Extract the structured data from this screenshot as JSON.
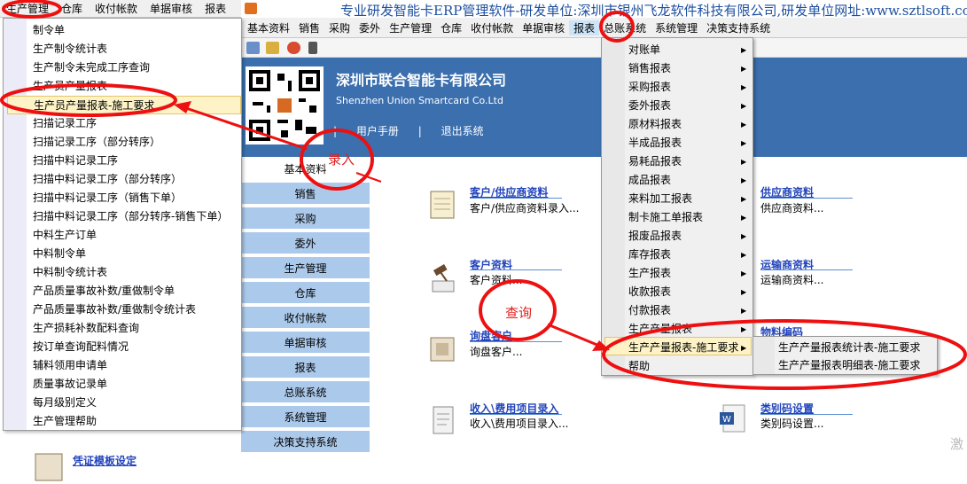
{
  "outer_menu": [
    "生产管理",
    "仓库",
    "收付帐款",
    "单据审核",
    "报表"
  ],
  "left_menu": [
    "制令单",
    "生产制令统计表",
    "生产制令未完成工序查询",
    "生产员产量报表",
    "生产员产量报表-施工要求",
    "扫描记录工序",
    "扫描记录工序（部分转序）",
    "扫描中料记录工序",
    "扫描中料记录工序（部分转序）",
    "扫描中料记录工序（销售下单）",
    "扫描中料记录工序（部分转序-销售下单）",
    "中料生产订单",
    "中料制令单",
    "中料制令统计表",
    "产品质量事故补数/重做制令单",
    "产品质量事故补数/重做制令统计表",
    "生产损耗补数配料查询",
    "按订单查询配料情况",
    "辅料领用申请单",
    "质量事故记录单",
    "每月级别定义",
    "生产管理帮助"
  ],
  "title_banner": "专业研发智能卡ERP管理软件-研发单位:深圳市银州飞龙软件科技有限公司,研发单位网址:www.sztlsoft.com",
  "main_menu": [
    "基本资料",
    "销售",
    "采购",
    "委外",
    "生产管理",
    "仓库",
    "收付帐款",
    "单据审核",
    "报表",
    "总账系统",
    "系统管理",
    "决策支持系统"
  ],
  "banner": {
    "company_cn": "深圳市联合智能卡有限公司",
    "company_en": "Shenzhen Union Smartcard Co.Ltd",
    "links": [
      "|",
      "用户手册",
      "|",
      "退出系统"
    ]
  },
  "side_nav": [
    "基本资料",
    "销售",
    "采购",
    "委外",
    "生产管理",
    "仓库",
    "收付帐款",
    "单据审核",
    "报表",
    "总账系统",
    "系统管理",
    "决策支持系统"
  ],
  "tiles": [
    {
      "title": "客户/供应商资料",
      "desc": "客户/供应商资料录入..."
    },
    {
      "title": "客户资料",
      "desc": "客户资料..."
    },
    {
      "title": "询盘客户",
      "desc": "询盘客户..."
    },
    {
      "title": "收入\\费用项目录入",
      "desc": "收入\\费用项目录入..."
    },
    {
      "title": "供应商资料",
      "desc": "供应商资料..."
    },
    {
      "title": "运输商资料",
      "desc": "运输商资料..."
    },
    {
      "title": "物料编码",
      "desc": ""
    },
    {
      "title": "类别码设置",
      "desc": "类别码设置..."
    },
    {
      "title": "凭证模板设定",
      "desc": ""
    }
  ],
  "report_menu": [
    {
      "label": "对账单",
      "arrow": true
    },
    {
      "label": "销售报表",
      "arrow": true
    },
    {
      "label": "采购报表",
      "arrow": true
    },
    {
      "label": "委外报表",
      "arrow": true
    },
    {
      "label": "原材料报表",
      "arrow": true
    },
    {
      "label": "半成品报表",
      "arrow": true
    },
    {
      "label": "易耗品报表",
      "arrow": true
    },
    {
      "label": "成品报表",
      "arrow": true
    },
    {
      "label": "来料加工报表",
      "arrow": true
    },
    {
      "label": "制卡施工单报表",
      "arrow": true
    },
    {
      "label": "报废品报表",
      "arrow": true
    },
    {
      "label": "库存报表",
      "arrow": true
    },
    {
      "label": "生产报表",
      "arrow": true
    },
    {
      "label": "收款报表",
      "arrow": true
    },
    {
      "label": "付款报表",
      "arrow": true
    },
    {
      "label": "生产产量报表",
      "arrow": true
    },
    {
      "label": "生产产量报表-施工要求",
      "arrow": true
    },
    {
      "label": "帮助",
      "arrow": false
    }
  ],
  "submenu": [
    "生产产量报表统计表-施工要求",
    "生产产量报表明细表-施工要求"
  ],
  "annotations": {
    "entry": "录入",
    "query": "查询"
  },
  "watermark": "激"
}
